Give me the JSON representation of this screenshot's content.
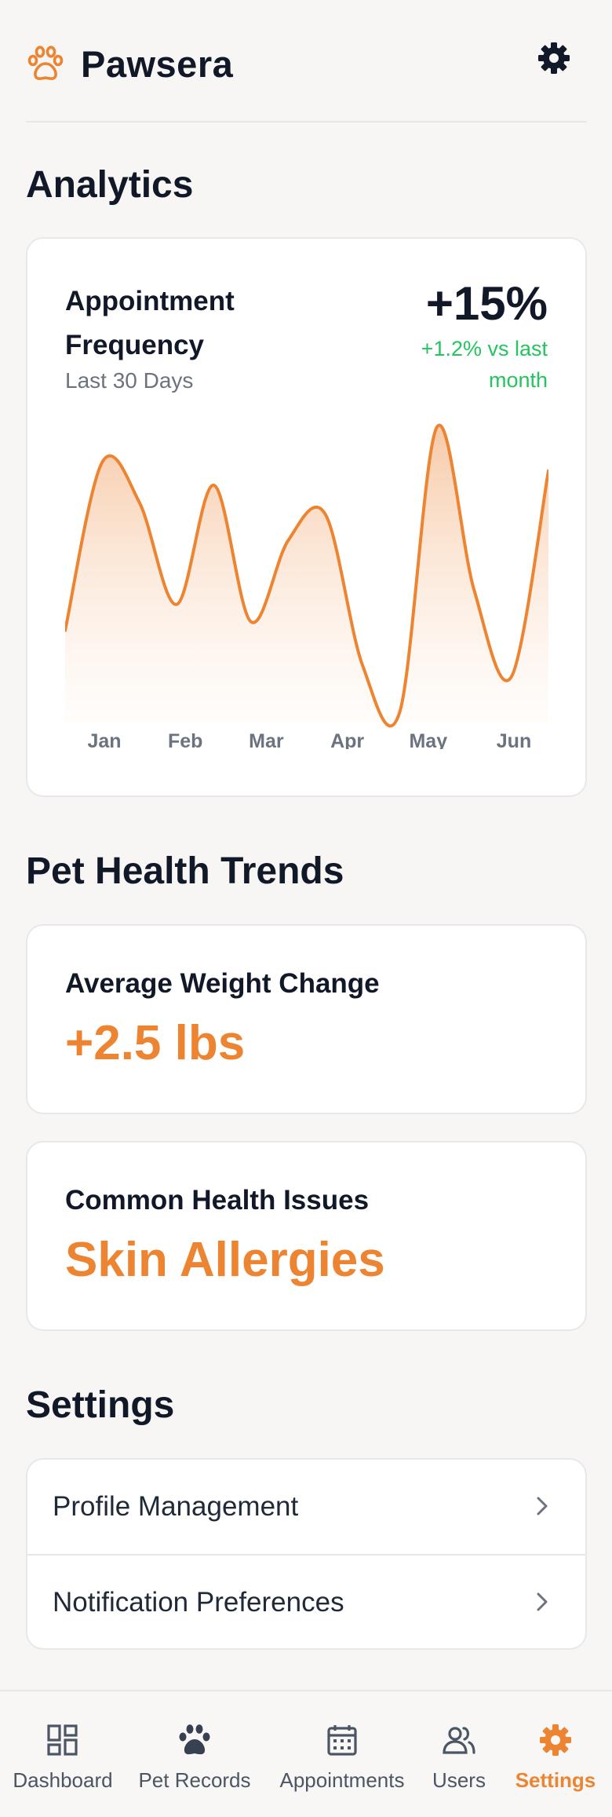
{
  "app": {
    "name": "Pawsera"
  },
  "colors": {
    "accent": "#ec8431",
    "positive": "#22c55e",
    "text": "#111827",
    "muted": "#6b7280"
  },
  "analytics": {
    "section_title": "Analytics",
    "card_title": "Appointment Frequency",
    "period": "Last 30 Days",
    "value": "+15%",
    "delta": "+1.2% vs last month"
  },
  "chart_data": {
    "type": "area",
    "title": "Appointment Frequency",
    "categories": [
      "Jan",
      "Feb",
      "Mar",
      "Apr",
      "May",
      "Jun"
    ],
    "series": [
      {
        "values": [
          0.3,
          0.88,
          0.74,
          0.39,
          0.8,
          0.33,
          0.61,
          0.7,
          0.18,
          0.02,
          1.0,
          0.44,
          0.14,
          0.85
        ]
      }
    ],
    "ylim": [
      0,
      1
    ],
    "grid": false,
    "color": "#ec8431"
  },
  "health": {
    "section_title": "Pet Health Trends",
    "weight_label": "Average Weight Change",
    "weight_value": "+2.5 lbs",
    "issues_label": "Common Health Issues",
    "issues_value": "Skin Allergies"
  },
  "settings": {
    "section_title": "Settings",
    "items": [
      {
        "label": "Profile Management",
        "icon": "chevron-right-icon"
      },
      {
        "label": "Notification Preferences",
        "icon": "chevron-right-icon"
      }
    ]
  },
  "nav": {
    "items": [
      {
        "label": "Dashboard",
        "icon": "dashboard-icon",
        "active": false
      },
      {
        "label": "Pet Records",
        "icon": "paw-icon",
        "active": false
      },
      {
        "label": "Appointments",
        "icon": "calendar-icon",
        "active": false
      },
      {
        "label": "Users",
        "icon": "users-icon",
        "active": false
      },
      {
        "label": "Settings",
        "icon": "gear-icon",
        "active": true
      }
    ]
  }
}
